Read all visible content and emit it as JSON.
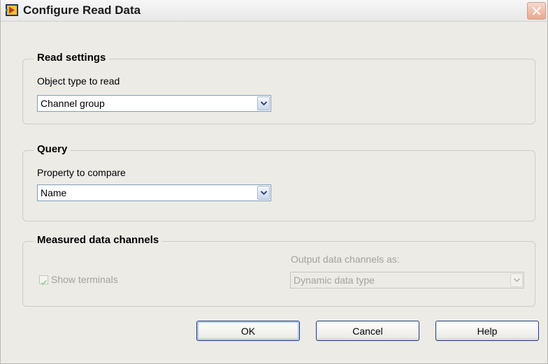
{
  "window": {
    "title": "Configure Read Data",
    "icon": "labview-express-vi-icon",
    "close_icon": "close-icon"
  },
  "read_settings": {
    "group_title": "Read settings",
    "object_type_label": "Object type to read",
    "object_type_value": "Channel group"
  },
  "query": {
    "group_title": "Query",
    "property_label": "Property to compare",
    "property_value": "Name"
  },
  "measured": {
    "group_title": "Measured data channels",
    "show_terminals_label": "Show terminals",
    "show_terminals_checked": true,
    "output_label": "Output data channels as:",
    "output_value": "Dynamic data type",
    "disabled": true
  },
  "buttons": {
    "ok": "OK",
    "cancel": "Cancel",
    "help": "Help"
  },
  "colors": {
    "dialog_background": "#ecebe6",
    "button_border": "#1c3b7a",
    "disabled_text": "#a3a29b"
  }
}
